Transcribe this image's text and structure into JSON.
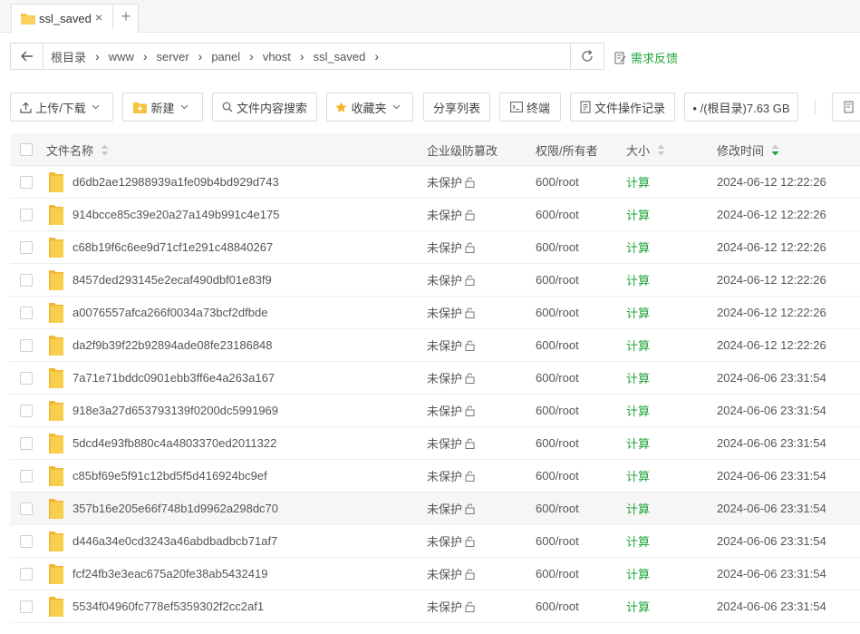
{
  "tab": {
    "label": "ssl_saved",
    "close": "×",
    "add": "+"
  },
  "breadcrumb": [
    "根目录",
    "www",
    "server",
    "panel",
    "vhost",
    "ssl_saved"
  ],
  "feedback_label": "需求反馈",
  "toolbar": {
    "upload": "上传/下载",
    "new": "新建",
    "search": "文件内容搜索",
    "favorites": "收藏夹",
    "share": "分享列表",
    "terminal": "终端",
    "oplog": "文件操作记录",
    "disk": "• /(根目录)7.63 GB"
  },
  "columns": {
    "name": "文件名称",
    "protect": "企业级防篡改",
    "perm": "权限/所有者",
    "size": "大小",
    "mtime": "修改时间"
  },
  "rows": [
    {
      "name": "d6db2ae12988939a1fe09b4bd929d743",
      "protect": "未保护",
      "perm": "600/root",
      "size": "计算",
      "mtime": "2024-06-12 12:22:26"
    },
    {
      "name": "914bcce85c39e20a27a149b991c4e175",
      "protect": "未保护",
      "perm": "600/root",
      "size": "计算",
      "mtime": "2024-06-12 12:22:26"
    },
    {
      "name": "c68b19f6c6ee9d71cf1e291c48840267",
      "protect": "未保护",
      "perm": "600/root",
      "size": "计算",
      "mtime": "2024-06-12 12:22:26"
    },
    {
      "name": "8457ded293145e2ecaf490dbf01e83f9",
      "protect": "未保护",
      "perm": "600/root",
      "size": "计算",
      "mtime": "2024-06-12 12:22:26"
    },
    {
      "name": "a0076557afca266f0034a73bcf2dfbde",
      "protect": "未保护",
      "perm": "600/root",
      "size": "计算",
      "mtime": "2024-06-12 12:22:26"
    },
    {
      "name": "da2f9b39f22b92894ade08fe23186848",
      "protect": "未保护",
      "perm": "600/root",
      "size": "计算",
      "mtime": "2024-06-12 12:22:26"
    },
    {
      "name": "7a71e71bddc0901ebb3ff6e4a263a167",
      "protect": "未保护",
      "perm": "600/root",
      "size": "计算",
      "mtime": "2024-06-06 23:31:54"
    },
    {
      "name": "918e3a27d653793139f0200dc5991969",
      "protect": "未保护",
      "perm": "600/root",
      "size": "计算",
      "mtime": "2024-06-06 23:31:54"
    },
    {
      "name": "5dcd4e93fb880c4a4803370ed2011322",
      "protect": "未保护",
      "perm": "600/root",
      "size": "计算",
      "mtime": "2024-06-06 23:31:54"
    },
    {
      "name": "c85bf69e5f91c12bd5f5d416924bc9ef",
      "protect": "未保护",
      "perm": "600/root",
      "size": "计算",
      "mtime": "2024-06-06 23:31:54"
    },
    {
      "name": "357b16e205e66f748b1d9962a298dc70",
      "protect": "未保护",
      "perm": "600/root",
      "size": "计算",
      "mtime": "2024-06-06 23:31:54"
    },
    {
      "name": "d446a34e0cd3243a46abdbadbcb71af7",
      "protect": "未保护",
      "perm": "600/root",
      "size": "计算",
      "mtime": "2024-06-06 23:31:54"
    },
    {
      "name": "fcf24fb3e3eac675a20fe38ab5432419",
      "protect": "未保护",
      "perm": "600/root",
      "size": "计算",
      "mtime": "2024-06-06 23:31:54"
    },
    {
      "name": "5534f04960fc778ef5359302f2cc2af1",
      "protect": "未保护",
      "perm": "600/root",
      "size": "计算",
      "mtime": "2024-06-06 23:31:54"
    }
  ],
  "colors": {
    "accent": "#20a53a",
    "folder": "#f7c33f",
    "header_bg": "#f5f6f7"
  }
}
